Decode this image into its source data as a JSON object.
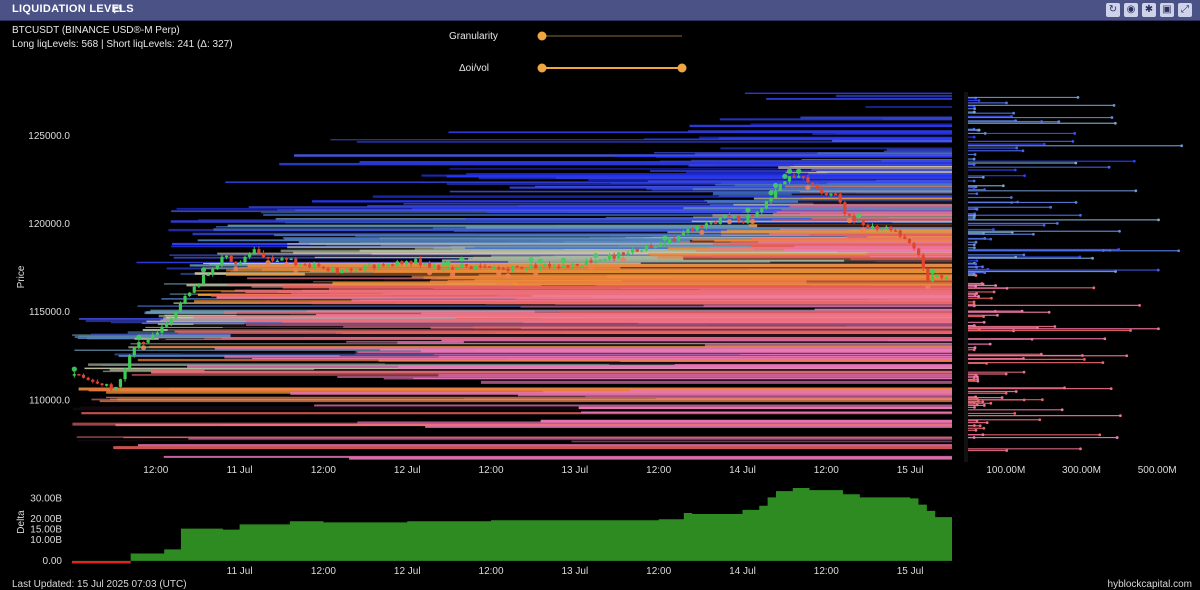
{
  "window": {
    "title": "LIQUIDATION LEVELS",
    "toolbar_icons": [
      "refresh-icon",
      "camera-icon",
      "gear-icon",
      "save-icon",
      "expand-icon"
    ]
  },
  "header": {
    "pair": "BTCUSDT (BINANCE USD®-M Perp)",
    "levels_summary": "Long liqLevels: 568 | Short liqLevels: 241 (Δ: 327)"
  },
  "controls": {
    "granularity_label": "Granularity",
    "granularity_value": 0.0,
    "oivol_label": "Δoi/vol",
    "oivol_range": [
      0.0,
      1.0
    ]
  },
  "footer": {
    "updated": "Last Updated: 15 Jul 2025 07:03 (UTC)",
    "source": "hyblockcapital.com"
  },
  "colors": {
    "short_levels": "#2a2cff",
    "long_levels": "#f07fc4",
    "candle_up": "#3ecb55",
    "candle_down": "#e0452f",
    "delta_fill": "#2e8b22",
    "delta_negative": "#e02020",
    "slider": "#f0a640"
  },
  "chart_data": [
    {
      "type": "line",
      "ylabel": "Price",
      "ylim": [
        106500,
        127500
      ],
      "yticks": [
        {
          "v": 110000,
          "label": "110000.0"
        },
        {
          "v": 115000,
          "label": "115000.0"
        },
        {
          "v": 120000,
          "label": "120000.0"
        },
        {
          "v": 125000,
          "label": "125000.0"
        }
      ],
      "xticks": [
        {
          "v": 0.5,
          "label": "12:00"
        },
        {
          "v": 1.0,
          "label": "11 Jul"
        },
        {
          "v": 1.5,
          "label": "12:00"
        },
        {
          "v": 2.0,
          "label": "12 Jul"
        },
        {
          "v": 2.5,
          "label": "12:00"
        },
        {
          "v": 3.0,
          "label": "13 Jul"
        },
        {
          "v": 3.5,
          "label": "12:00"
        },
        {
          "v": 4.0,
          "label": "14 Jul"
        },
        {
          "v": 4.5,
          "label": "12:00"
        },
        {
          "v": 5.0,
          "label": "15 Jul"
        }
      ],
      "xlim": [
        0.0,
        5.25
      ],
      "series": [
        {
          "x": [
            0.0,
            0.1,
            0.2,
            0.25,
            0.3,
            0.36,
            0.45,
            0.55,
            0.65,
            0.72,
            0.8,
            0.9,
            1.0,
            1.08,
            1.2,
            1.3,
            1.35,
            1.45,
            1.6,
            1.75,
            1.9,
            2.05,
            2.2,
            2.35,
            2.5,
            2.65,
            2.8,
            3.0,
            3.2,
            3.4,
            3.6,
            3.7,
            3.8,
            3.9,
            4.0,
            4.1,
            4.15,
            4.22,
            4.3,
            4.4,
            4.5,
            4.55,
            4.6,
            4.7,
            4.8,
            4.9,
            5.0,
            5.05,
            5.1,
            5.15,
            5.25
          ],
          "values": [
            111400,
            111200,
            110900,
            110700,
            111300,
            112800,
            113600,
            114100,
            115600,
            116400,
            117100,
            118200,
            117800,
            118500,
            117900,
            118200,
            117600,
            117700,
            117300,
            117600,
            117700,
            117900,
            117500,
            117600,
            117400,
            117500,
            117600,
            117700,
            118100,
            118600,
            119200,
            119700,
            120000,
            120400,
            120200,
            120700,
            121300,
            122300,
            122700,
            122400,
            121700,
            121800,
            120800,
            120000,
            119800,
            119700,
            118900,
            118300,
            116800,
            117000,
            117100
          ]
        }
      ],
      "side_histogram": {
        "xticks": [
          "100.00M",
          "300.00M",
          "500.00M"
        ],
        "xlim": [
          0,
          600
        ]
      }
    },
    {
      "type": "area",
      "ylabel": "Delta",
      "yticks": [
        {
          "v": 0,
          "label": "0.00"
        },
        {
          "v": 10,
          "label": "10.00B"
        },
        {
          "v": 15,
          "label": "15.00B"
        },
        {
          "v": 20,
          "label": "20.00B"
        },
        {
          "v": 30,
          "label": "30.00B"
        }
      ],
      "ylim": [
        -2,
        35
      ],
      "x": [
        0.0,
        0.3,
        0.35,
        0.55,
        0.65,
        0.9,
        1.0,
        1.3,
        1.5,
        2.0,
        2.5,
        3.0,
        3.5,
        3.65,
        3.7,
        4.0,
        4.1,
        4.15,
        4.2,
        4.3,
        4.4,
        4.6,
        4.7,
        5.0,
        5.05,
        5.1,
        5.15,
        5.25
      ],
      "values": [
        -0.8,
        -0.8,
        3.5,
        5.5,
        15.5,
        15.0,
        17.5,
        19.0,
        18.5,
        19.0,
        19.5,
        19.5,
        20.0,
        23.0,
        22.5,
        24.5,
        26.5,
        30.5,
        33.5,
        35.0,
        34.0,
        32.0,
        30.5,
        30.0,
        27.0,
        24.0,
        21.0,
        20.5
      ],
      "xticks": [
        {
          "v": 1.0,
          "label": "11 Jul"
        },
        {
          "v": 1.5,
          "label": "12:00"
        },
        {
          "v": 2.0,
          "label": "12 Jul"
        },
        {
          "v": 2.5,
          "label": "12:00"
        },
        {
          "v": 3.0,
          "label": "13 Jul"
        },
        {
          "v": 3.5,
          "label": "12:00"
        },
        {
          "v": 4.0,
          "label": "14 Jul"
        },
        {
          "v": 4.5,
          "label": "12:00"
        },
        {
          "v": 5.0,
          "label": "15 Jul"
        }
      ],
      "xlim": [
        0.0,
        5.25
      ]
    }
  ]
}
